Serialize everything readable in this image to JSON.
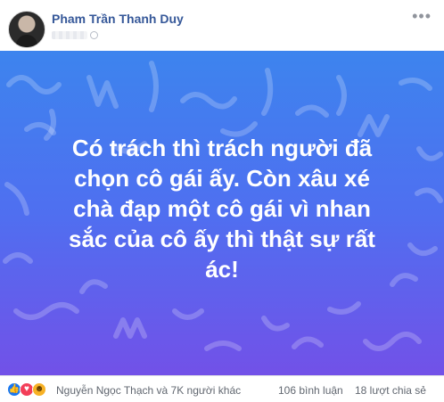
{
  "post": {
    "author": "Pham Trần Thanh Duy",
    "more_label": "•••",
    "quote": "Có trách thì trách người đã\nchọn cô gái ấy. Còn xâu xé\nchà đạp một cô gái vì nhan\nsắc của cô ấy thì thật sự rất\nác!"
  },
  "footer": {
    "reactions_text": "Nguyễn Ngọc Thạch và 7K người khác",
    "comments": "106 bình luận",
    "shares": "18 lượt chia sẻ"
  },
  "icons": {
    "like": "like-icon",
    "love": "love-icon",
    "haha": "haha-icon"
  },
  "colors": {
    "author": "#365899",
    "card_top": "#3d84ee",
    "card_bottom": "#7251e8",
    "like": "#1877f2",
    "love": "#f33e58",
    "haha": "#f7b125"
  }
}
